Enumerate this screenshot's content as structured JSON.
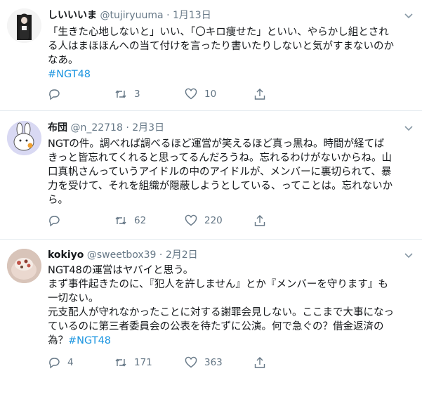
{
  "tweets": [
    {
      "name": "しいいいま",
      "handle": "@tujiryuuma",
      "date": "1月13日",
      "lines": [
        "「生きた心地しないと」いい、「〇キロ痩せた」といい、やらかし組とされ",
        "る人はまほほんへの当て付けを言ったり書いたりしないと気がすまないのか",
        "なあ。"
      ],
      "hashtag": "#NGT48",
      "replies": "",
      "retweets": "3",
      "likes": "10"
    },
    {
      "name": "布団",
      "handle": "@n_22718",
      "date": "2月3日",
      "lines": [
        "NGTの件。調べれば調べるほど運営が笑えるほど真っ黒ね。時間が経てば",
        "きっと皆忘れてくれると思ってるんだろうね。忘れるわけがないからね。山",
        "口真帆さんっていうアイドルの中のアイドルが、メンバーに裏切られて、暴",
        "力を受けて、それを組織が隠蔽しようとしている、ってことは。忘れないか",
        "ら。"
      ],
      "replies": "",
      "retweets": "62",
      "likes": "220"
    },
    {
      "name": "kokiyo",
      "handle": "@sweetbox39",
      "date": "2月2日",
      "lines": [
        "NGT48の運営はヤバイと思う。",
        "まず事件起きたのに、『犯人を許しません』とか『メンバーを守ります』も",
        "一切ない。",
        "元支配人が守れなかったことに対する謝罪会見しない。ここまで大事になっ",
        "ているのに第三者委員会の公表を待たずに公演。何で急ぐの？借金返済の"
      ],
      "last_line_prefix": "為？",
      "hashtag": "#NGT48",
      "replies": "4",
      "retweets": "171",
      "likes": "363"
    }
  ],
  "separator": "·",
  "icons": [
    "avatar",
    "chevron-down-icon",
    "reply-icon",
    "retweet-icon",
    "like-icon",
    "share-icon"
  ],
  "colors": {
    "secondary": "#657786",
    "link": "#1b95e0",
    "border": "#e6ecf0"
  }
}
